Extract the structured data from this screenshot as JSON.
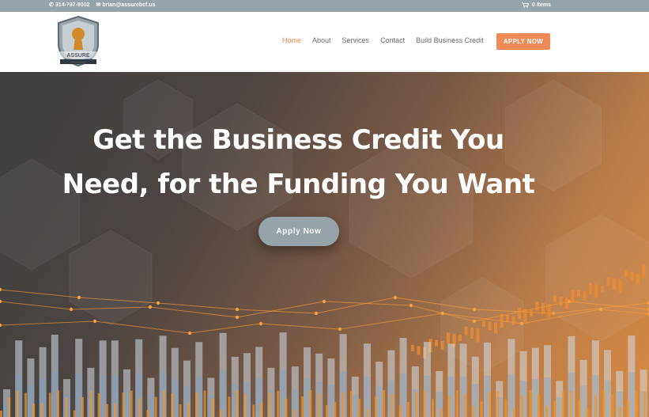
{
  "topbar": {
    "phone_icon": "phone-icon",
    "phone": "314-797-9002",
    "email_icon": "envelope-icon",
    "email": "brian@assurebcf.us",
    "cart_icon": "cart-icon",
    "cart": "0 Items"
  },
  "header": {
    "logo_icon": "keyhole-shield-logo",
    "nav": [
      "Home",
      "About",
      "Services",
      "Contact",
      "Build Business Credit"
    ],
    "active_index": 0,
    "apply_label": "APPLY NOW"
  },
  "hero": {
    "headline_line1": "Get the Business Credit You",
    "headline_line2": "Need, for the Funding You Want",
    "button_label": "Apply Now"
  },
  "colors": {
    "topbar": "#96a3aa",
    "accent": "#ef8a57",
    "active_nav": "#e58b4a",
    "hero_button": "#98a3a9"
  }
}
